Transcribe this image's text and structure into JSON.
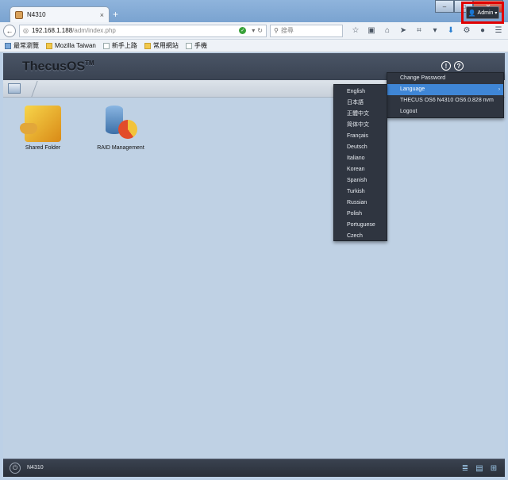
{
  "browser": {
    "tab_title": "N4310",
    "new_tab": "+",
    "tab_close": "×",
    "url_host": "192.168.1.188",
    "url_path": "/adm/index.php",
    "search_placeholder": "搜尋",
    "window_minimize": "–",
    "window_maximize": "□",
    "window_close": "✕"
  },
  "bookmarks": [
    {
      "label": "最常瀏覽",
      "icon": "star"
    },
    {
      "label": "Mozilla Taiwan",
      "icon": "folder"
    },
    {
      "label": "新手上路",
      "icon": "page"
    },
    {
      "label": "常用網站",
      "icon": "folder"
    },
    {
      "label": "手機",
      "icon": "page"
    }
  ],
  "app": {
    "logo": "ThecusOS",
    "logo_tm": "TM",
    "info_icon": "!",
    "help_icon": "?",
    "admin_label": "Admin"
  },
  "desktop": {
    "icons": [
      {
        "label": "Shared Folder"
      },
      {
        "label": "RAID Management"
      }
    ]
  },
  "user_menu": {
    "items": [
      "Change Password",
      "Language",
      "THECUS OS6 N4310 OS6.0.828 nvm",
      "Logout"
    ],
    "active_index": 1
  },
  "language_menu": {
    "items": [
      "English",
      "日本語",
      "正體中文",
      "简体中文",
      "Français",
      "Deutsch",
      "Italiano",
      "Korean",
      "Spanish",
      "Turkish",
      "Russian",
      "Polish",
      "Portuguese",
      "Czech"
    ]
  },
  "taskbar": {
    "name": "N4310"
  },
  "colors": {
    "highlight_red": "#e00000",
    "menu_active": "#3f86d6",
    "menu_bg": "#2f3540"
  }
}
